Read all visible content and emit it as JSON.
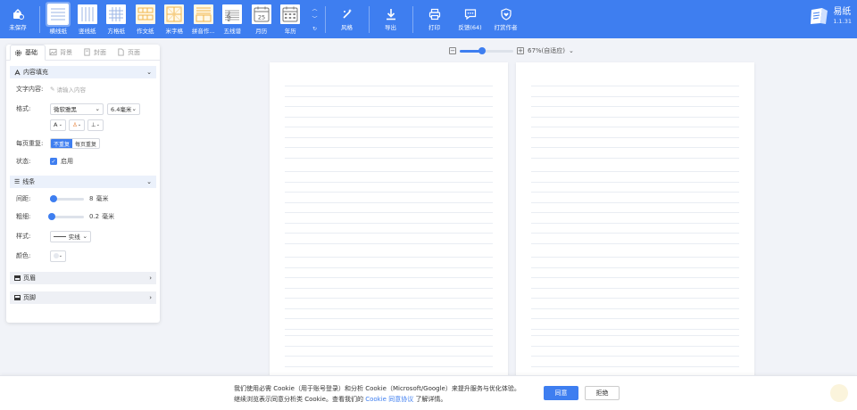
{
  "toolbar": {
    "unsaved": "未保存",
    "papers": [
      {
        "label": "横线纸",
        "icon": "horizontal-lines-icon"
      },
      {
        "label": "竖线纸",
        "icon": "vertical-lines-icon"
      },
      {
        "label": "方格纸",
        "icon": "grid-icon"
      },
      {
        "label": "作文纸",
        "icon": "essay-grid-icon"
      },
      {
        "label": "米字格",
        "icon": "mi-grid-icon"
      },
      {
        "label": "拼音作...",
        "icon": "pinyin-grid-icon"
      },
      {
        "label": "五线谱",
        "icon": "staff-icon"
      },
      {
        "label": "月历",
        "icon": "month-calendar-icon",
        "number": "25"
      },
      {
        "label": "年历",
        "icon": "year-calendar-icon"
      }
    ],
    "actions": [
      {
        "label": "风格",
        "icon": "magic-wand-icon"
      },
      {
        "label": "导出",
        "icon": "download-icon"
      },
      {
        "label": "打印",
        "icon": "printer-icon"
      },
      {
        "label": "反馈(64)",
        "icon": "chat-icon"
      },
      {
        "label": "打赏作者",
        "icon": "heart-shield-icon"
      }
    ],
    "brand": {
      "name": "易纸",
      "version": "1.1.31"
    }
  },
  "panel": {
    "tabs": [
      {
        "label": "基础",
        "icon": "gear-icon"
      },
      {
        "label": "背景",
        "icon": "image-icon"
      },
      {
        "label": "封面",
        "icon": "cover-icon"
      },
      {
        "label": "页面",
        "icon": "page-icon"
      }
    ],
    "content_section": "内容填充",
    "text_content_label": "文字内容:",
    "text_content_placeholder": "请输入内容",
    "format_label": "格式:",
    "font": "微软雅黑",
    "font_size": "6.4毫米",
    "font_color_btn": "A",
    "repeat_label": "每页重复:",
    "repeat_options": [
      "不重复",
      "每页重复"
    ],
    "status_label": "状态:",
    "enabled_label": "启用",
    "lines_section": "线条",
    "spacing_label": "间距:",
    "spacing_value": "8",
    "spacing_unit": "毫米",
    "spacing_level": 0.1,
    "thickness_label": "粗细:",
    "thickness_value": "0.2",
    "thickness_unit": "毫米",
    "thickness_level": 0.05,
    "style_label": "样式:",
    "style_value": "实线",
    "color_label": "颜色:",
    "header_section": "页眉",
    "footer_section": "页脚"
  },
  "zoom": {
    "value": "67%(自适应)",
    "level": 0.42
  },
  "cookie": {
    "line1": "我们使用必需 Cookie（用于账号登录）和分析 Cookie（Microsoft/Google）来提升服务与优化体验。",
    "line2_pre": "继续浏览表示同意分析类 Cookie。查看我们的",
    "link": "Cookie 同意协议",
    "line2_post": "了解详情。",
    "accept": "同意",
    "reject": "拒绝"
  }
}
